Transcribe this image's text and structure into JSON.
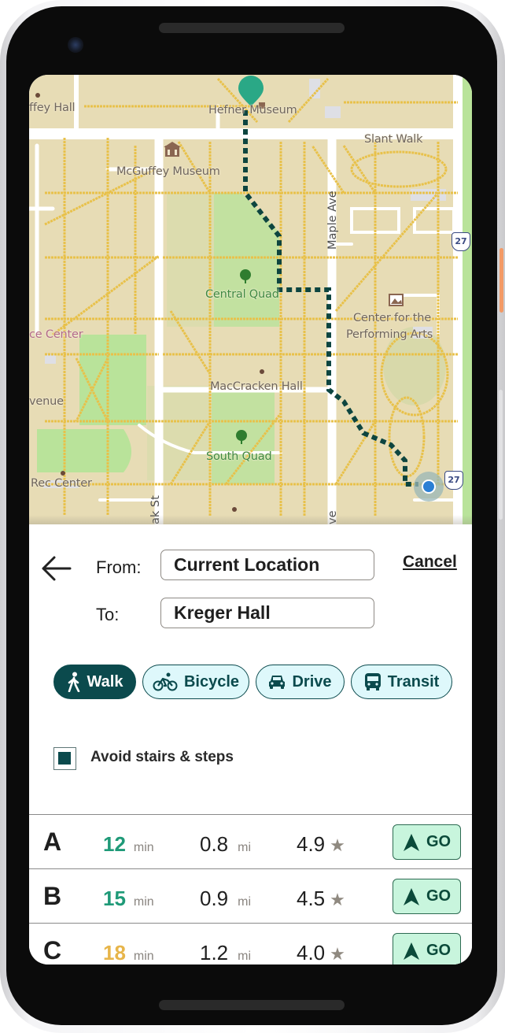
{
  "map": {
    "labels": {
      "mcguffey_hall": "ffey Hall",
      "hefner_museum": "Hefner Museum",
      "mcguffey_museum": "McGuffey Museum",
      "slant_walk": "Slant Walk",
      "central_quad": "Central Quad",
      "center_performing_arts_1": "Center for the",
      "center_performing_arts_2": "Performing Arts",
      "science_center": "ce Center",
      "maccracken_hall": "MacCracken Hall",
      "avenue": "venue",
      "south_quad": "South Quad",
      "rec_center": "Rec Center",
      "maple_ave": "Maple Ave",
      "oak_st": "ak St",
      "maple_ave_bottom": "ve",
      "route_shield_top": "27",
      "route_shield_bottom": "27"
    },
    "colors": {
      "route_path": "#0d4540",
      "destination_pin": "#2aa886",
      "current_location": "#2b7fd4"
    }
  },
  "directions": {
    "back_icon": "arrow-left-icon",
    "from_label": "From:",
    "from_value": "Current Location",
    "to_label": "To:",
    "to_value": "Kreger Hall",
    "cancel_label": "Cancel"
  },
  "modes": [
    {
      "label": "Walk",
      "icon": "walk-icon",
      "selected": true
    },
    {
      "label": "Bicycle",
      "icon": "bicycle-icon",
      "selected": false
    },
    {
      "label": "Drive",
      "icon": "car-icon",
      "selected": false
    },
    {
      "label": "Transit",
      "icon": "bus-icon",
      "selected": false
    }
  ],
  "options": {
    "avoid_stairs_label": "Avoid stairs & steps",
    "avoid_stairs_checked": true
  },
  "routes": [
    {
      "letter": "A",
      "time": "12",
      "time_unit": "min",
      "time_color": "#1f9a78",
      "distance": "0.8",
      "distance_unit": "mi",
      "rating": "4.9",
      "star": "★",
      "go_label": "GO"
    },
    {
      "letter": "B",
      "time": "15",
      "time_unit": "min",
      "time_color": "#1f9a78",
      "distance": "0.9",
      "distance_unit": "mi",
      "rating": "4.5",
      "star": "★",
      "go_label": "GO"
    },
    {
      "letter": "C",
      "time": "18",
      "time_unit": "min",
      "time_color": "#e7b54a",
      "distance": "1.2",
      "distance_unit": "mi",
      "rating": "4.0",
      "star": "★",
      "go_label": "GO"
    }
  ]
}
